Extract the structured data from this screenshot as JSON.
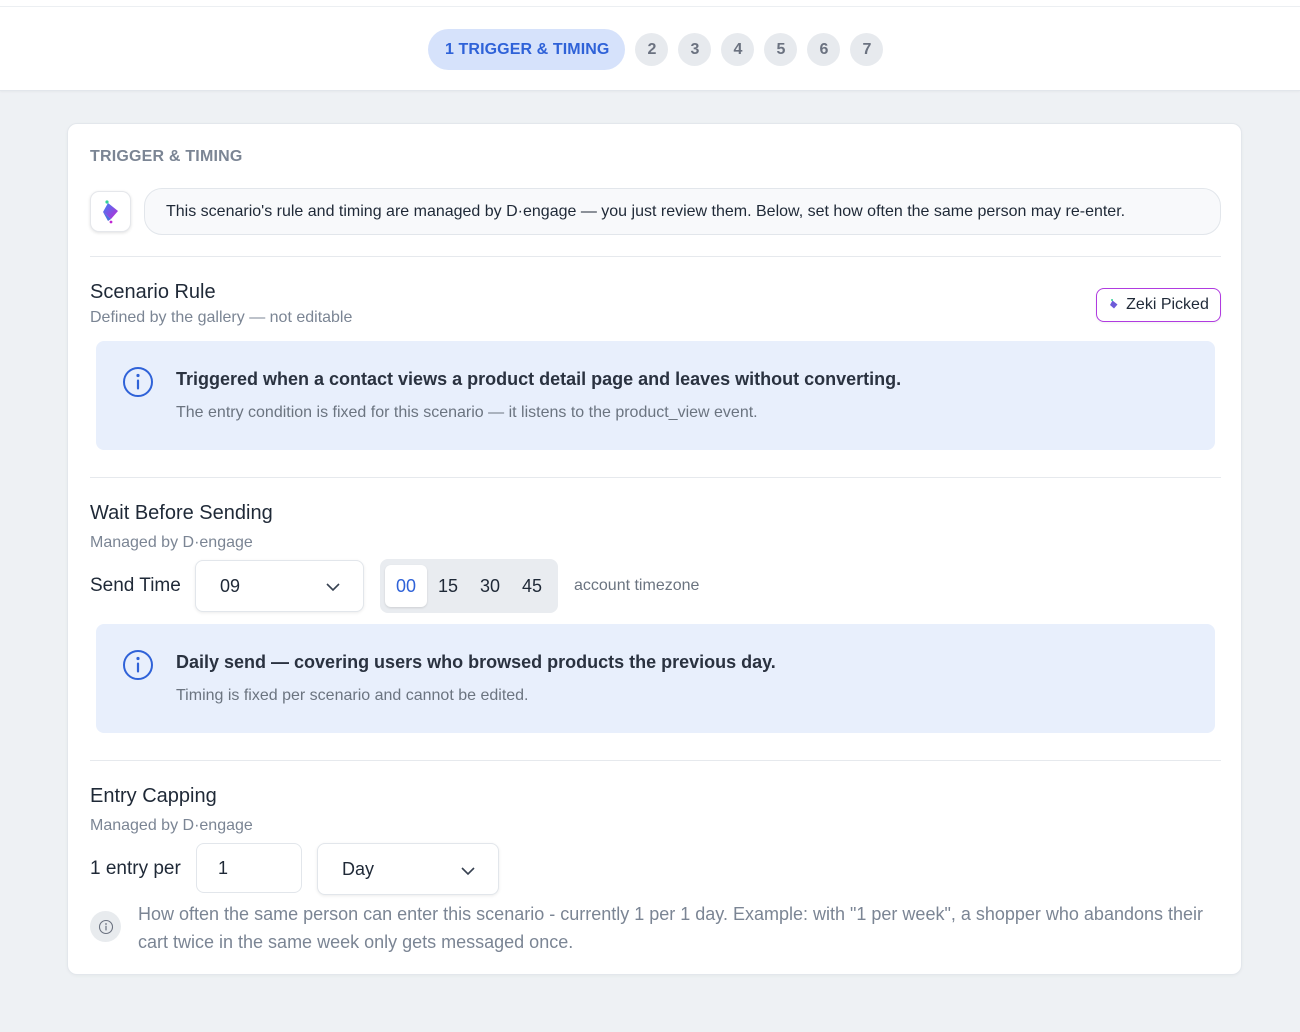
{
  "stepper": {
    "active_label": "1 TRIGGER & TIMING",
    "steps": [
      "2",
      "3",
      "4",
      "5",
      "6",
      "7"
    ]
  },
  "card": {
    "section_title": "TRIGGER & TIMING",
    "intro": "This scenario's rule and timing are managed by D·engage — you just review them. Below, set how often the same person may re-enter."
  },
  "scenario_rule": {
    "title": "Scenario Rule",
    "subtitle": "Defined by the gallery — not editable",
    "badge": "Zeki Picked",
    "info_title": "Triggered when a contact views a product detail page and leaves without converting.",
    "info_text": "The entry condition is fixed for this scenario — it listens to the product_view event."
  },
  "wait": {
    "title": "Wait Before Sending",
    "subtitle": "Managed by D·engage",
    "send_time_label": "Send Time",
    "hour_value": "09",
    "minutes": [
      "00",
      "15",
      "30",
      "45"
    ],
    "selected_minute": "00",
    "timezone_note": "account timezone",
    "info_title": "Daily send — covering users who browsed products the previous day.",
    "info_text": "Timing is fixed per scenario and cannot be edited."
  },
  "capping": {
    "title": "Entry Capping",
    "subtitle": "Managed by D·engage",
    "label": "1 entry per",
    "count_value": "1",
    "period_value": "Day",
    "note": "How often the same person can enter this scenario - currently 1 per 1 day. Example: with \"1 per week\", a shopper who abandons their cart twice in the same week only gets messaged once."
  },
  "colors": {
    "accent": "#2f62d8",
    "active_step_bg": "#d6e2fb",
    "info_bg": "#e8effc",
    "badge_border": "#b03be0"
  }
}
